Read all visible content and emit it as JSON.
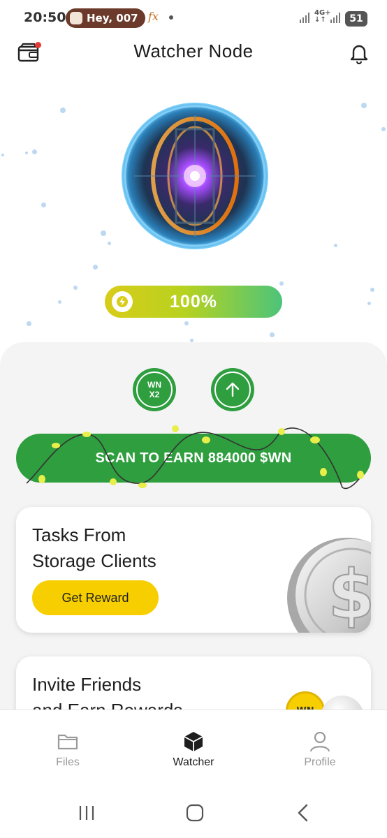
{
  "status_bar": {
    "time": "20:50",
    "notification_pill": "Hey, 007",
    "notification_app_icon": "fx-icon",
    "network_type": "4G+",
    "battery_level": "51"
  },
  "header": {
    "title": "Watcher Node",
    "left_icon": "wallet-icon",
    "right_icon": "bell-icon",
    "wallet_badge_color": "#e53935"
  },
  "energy": {
    "label": "100%",
    "level": 1.0,
    "icon": "lightning-icon"
  },
  "actions": {
    "boost_line1": "WN",
    "boost_line2": "X2",
    "upgrade_icon": "arrow-up-icon",
    "scan_label": "SCAN TO EARN 884000 $WN"
  },
  "cards": [
    {
      "title_line1": "Tasks From",
      "title_line2": "Storage Clients",
      "button_label": "Get Reward",
      "image_icon": "dollar-coin-icon"
    },
    {
      "title_line1": "Invite Friends",
      "title_line2": "and Earn Rewards",
      "image_icon": "wn-coin-icon",
      "coin_text": "WN"
    }
  ],
  "bottom_nav": {
    "items": [
      {
        "label": "Files",
        "icon": "folder-icon",
        "active": false
      },
      {
        "label": "Watcher",
        "icon": "cube-icon",
        "active": true
      },
      {
        "label": "Profile",
        "icon": "person-icon",
        "active": false
      }
    ]
  },
  "system_nav": {
    "recents_icon": "recents-icon",
    "home_icon": "home-icon",
    "back_icon": "back-icon"
  },
  "colors": {
    "accent_green": "#2e9e3e",
    "reward_yellow": "#f7cf00",
    "energy_start": "#d9cc1a",
    "energy_end": "#4cc47a"
  }
}
